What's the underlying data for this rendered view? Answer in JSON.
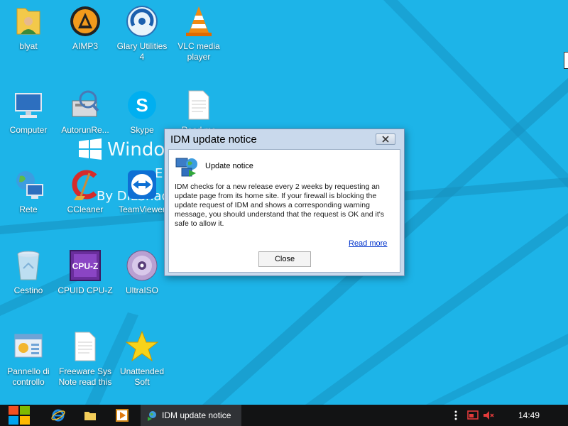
{
  "desktop": {
    "icons": [
      {
        "label": "blyat",
        "icon": "user-folder-icon"
      },
      {
        "label": "AIMP3",
        "icon": "aimp-icon"
      },
      {
        "label": "Glary Utilities 4",
        "icon": "glary-utilities-icon"
      },
      {
        "label": "VLC media player",
        "icon": "vlc-cone-icon"
      },
      {
        "label": "Computer",
        "icon": "computer-icon"
      },
      {
        "label": "AutorunRe...",
        "icon": "autorun-icon"
      },
      {
        "label": "Skype",
        "icon": "skype-icon"
      },
      {
        "label": "Read me",
        "icon": "text-document-icon"
      },
      {
        "label": "Rete",
        "icon": "network-globe-icon"
      },
      {
        "label": "CCleaner",
        "icon": "ccleaner-icon"
      },
      {
        "label": "TeamViewer",
        "icon": "teamviewer-icon"
      },
      {
        "label": "Cestino",
        "icon": "recycle-bin-icon"
      },
      {
        "label": "CPUID CPU-Z",
        "icon": "cpuz-icon"
      },
      {
        "label": "UltraISO",
        "icon": "ultraiso-disc-icon"
      },
      {
        "label": "Pannello di controllo",
        "icon": "control-panel-icon"
      },
      {
        "label": "Freeware Sys Note read this",
        "icon": "text-document-icon"
      },
      {
        "label": "Unattended Soft",
        "icon": "star-icon"
      }
    ],
    "wallpaper": {
      "line1": "Window",
      "line2": "E",
      "line3": "By DiLShad"
    }
  },
  "dialog": {
    "title": "IDM update notice",
    "header": "Update notice",
    "body": "IDM checks for a new release every 2 weeks by requesting an update page from its home site. If your firewall is blocking the update request of IDM and shows a corresponding warning message, you should understand that the request is OK and it's safe to allow it.",
    "read_more": "Read more",
    "close_label": "Close"
  },
  "taskbar": {
    "active_task": "IDM update notice",
    "clock": "14:49"
  },
  "colors": {
    "desktop_bg": "#1db4e8",
    "taskbar_bg": "#121314",
    "dialog_frame": "#c9d9ec",
    "link": "#0033cc"
  }
}
